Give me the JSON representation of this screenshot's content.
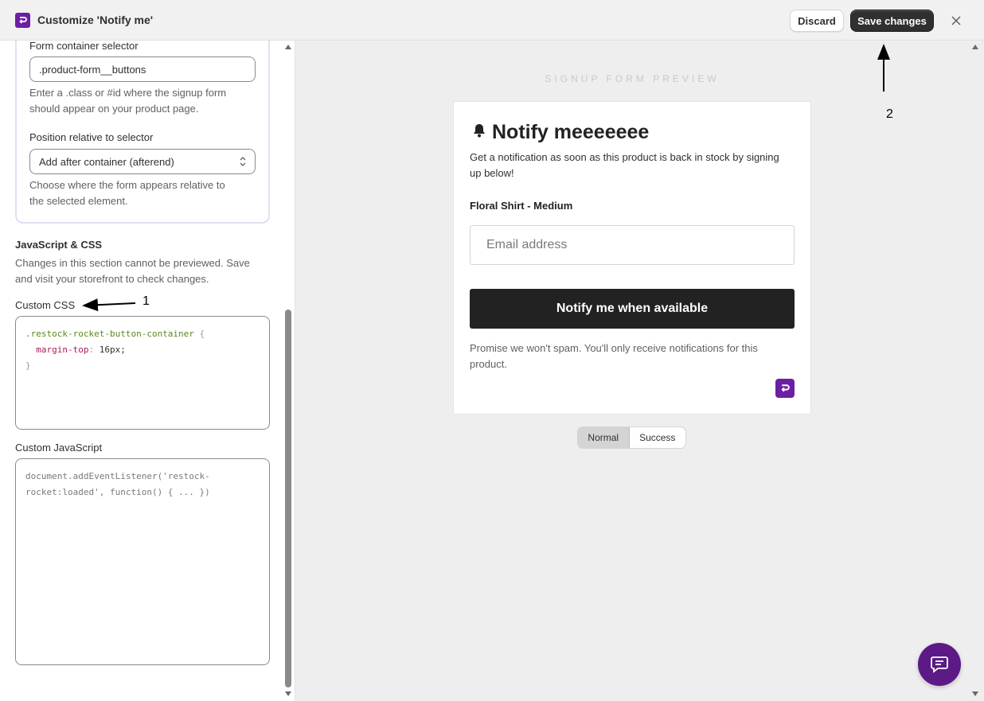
{
  "header": {
    "title": "Customize 'Notify me'",
    "discard_label": "Discard",
    "save_label": "Save changes",
    "brand_color": "#6d1fa4"
  },
  "left": {
    "container_selector": {
      "label": "Form container selector",
      "value": ".product-form__buttons",
      "help_line1": "Enter a .class or #id where the signup form",
      "help_line2": "should appear on your product page."
    },
    "position": {
      "label": "Position relative to selector",
      "value": "Add after container (afterend)",
      "help_line1": "Choose where the form appears relative to",
      "help_line2": "the selected element."
    },
    "js_css": {
      "heading": "JavaScript & CSS",
      "help_line1": "Changes in this section cannot be previewed. Save",
      "help_line2": "and visit your storefront to check changes."
    },
    "custom_css": {
      "label": "Custom CSS",
      "selector": ".restock-rocket-button-container",
      "open_brace": "{",
      "property": "margin-top",
      "colon": ":",
      "value": "16px;",
      "close_brace": "}"
    },
    "custom_js": {
      "label": "Custom JavaScript",
      "placeholder_line1": "document.addEventListener('restock-",
      "placeholder_line2": "rocket:loaded', function() { ... })"
    }
  },
  "annotations": {
    "one": "1",
    "two": "2"
  },
  "preview": {
    "caption": "SIGNUP FORM PREVIEW",
    "title": "Notify meeeeeee",
    "description": "Get a notification as soon as this product is back in stock by signing up below!",
    "variant": "Floral Shirt - Medium",
    "email_placeholder": "Email address",
    "button_label": "Notify me when available",
    "disclaimer": "Promise we won't spam. You'll only receive notifications for this product.",
    "toggle": {
      "normal": "Normal",
      "success": "Success",
      "selected": "Normal"
    }
  }
}
